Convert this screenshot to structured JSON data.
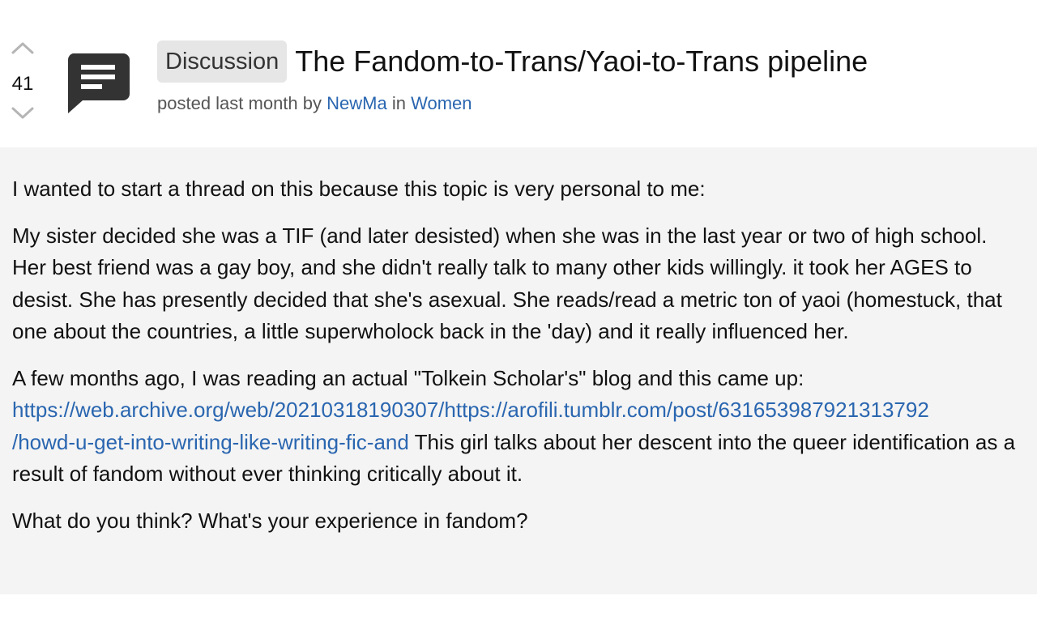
{
  "post": {
    "score": "41",
    "flair": "Discussion",
    "title": "The Fandom-to-Trans/Yaoi-to-Trans pipeline",
    "meta": {
      "prefix": "posted last month by",
      "author": "NewMa",
      "in_label": "in",
      "community": "Women"
    },
    "icons": {
      "upvote": "chevron-up-icon",
      "downvote": "chevron-down-icon",
      "thumbnail": "text-post-icon"
    },
    "body": {
      "p1": "I wanted to start a thread on this because this topic is very personal to me:",
      "p2": "My sister decided she was a TIF (and later desisted) when she was in the last year or two of high school. Her best friend was a gay boy, and she didn't really talk to many other kids willingly. it took her AGES to desist. She has presently decided that she's asexual. She reads/read a metric ton of yaoi (homestuck, that one about the countries, a little superwholock back in the 'day) and it really influenced her.",
      "p3_before": "A few months ago, I was reading an actual \"Tolkein Scholar's\" blog and this came up:",
      "p3_link_line1": "https://web.archive.org/web/20210318190307/https://arofili.tumblr.com/post/631653987921313792",
      "p3_link_line2": "/howd-u-get-into-writing-like-writing-fic-and",
      "p3_after": "This girl talks about her descent into the queer identification as a result of fandom without ever thinking critically about it.",
      "p4": "What do you think? What's your experience in fandom?"
    }
  },
  "colors": {
    "link": "#2a66b0",
    "flair_bg": "#e6e6e6",
    "body_bg": "#f4f4f4",
    "icon": "#333333",
    "vote_chevron": "#b5b5b5"
  }
}
